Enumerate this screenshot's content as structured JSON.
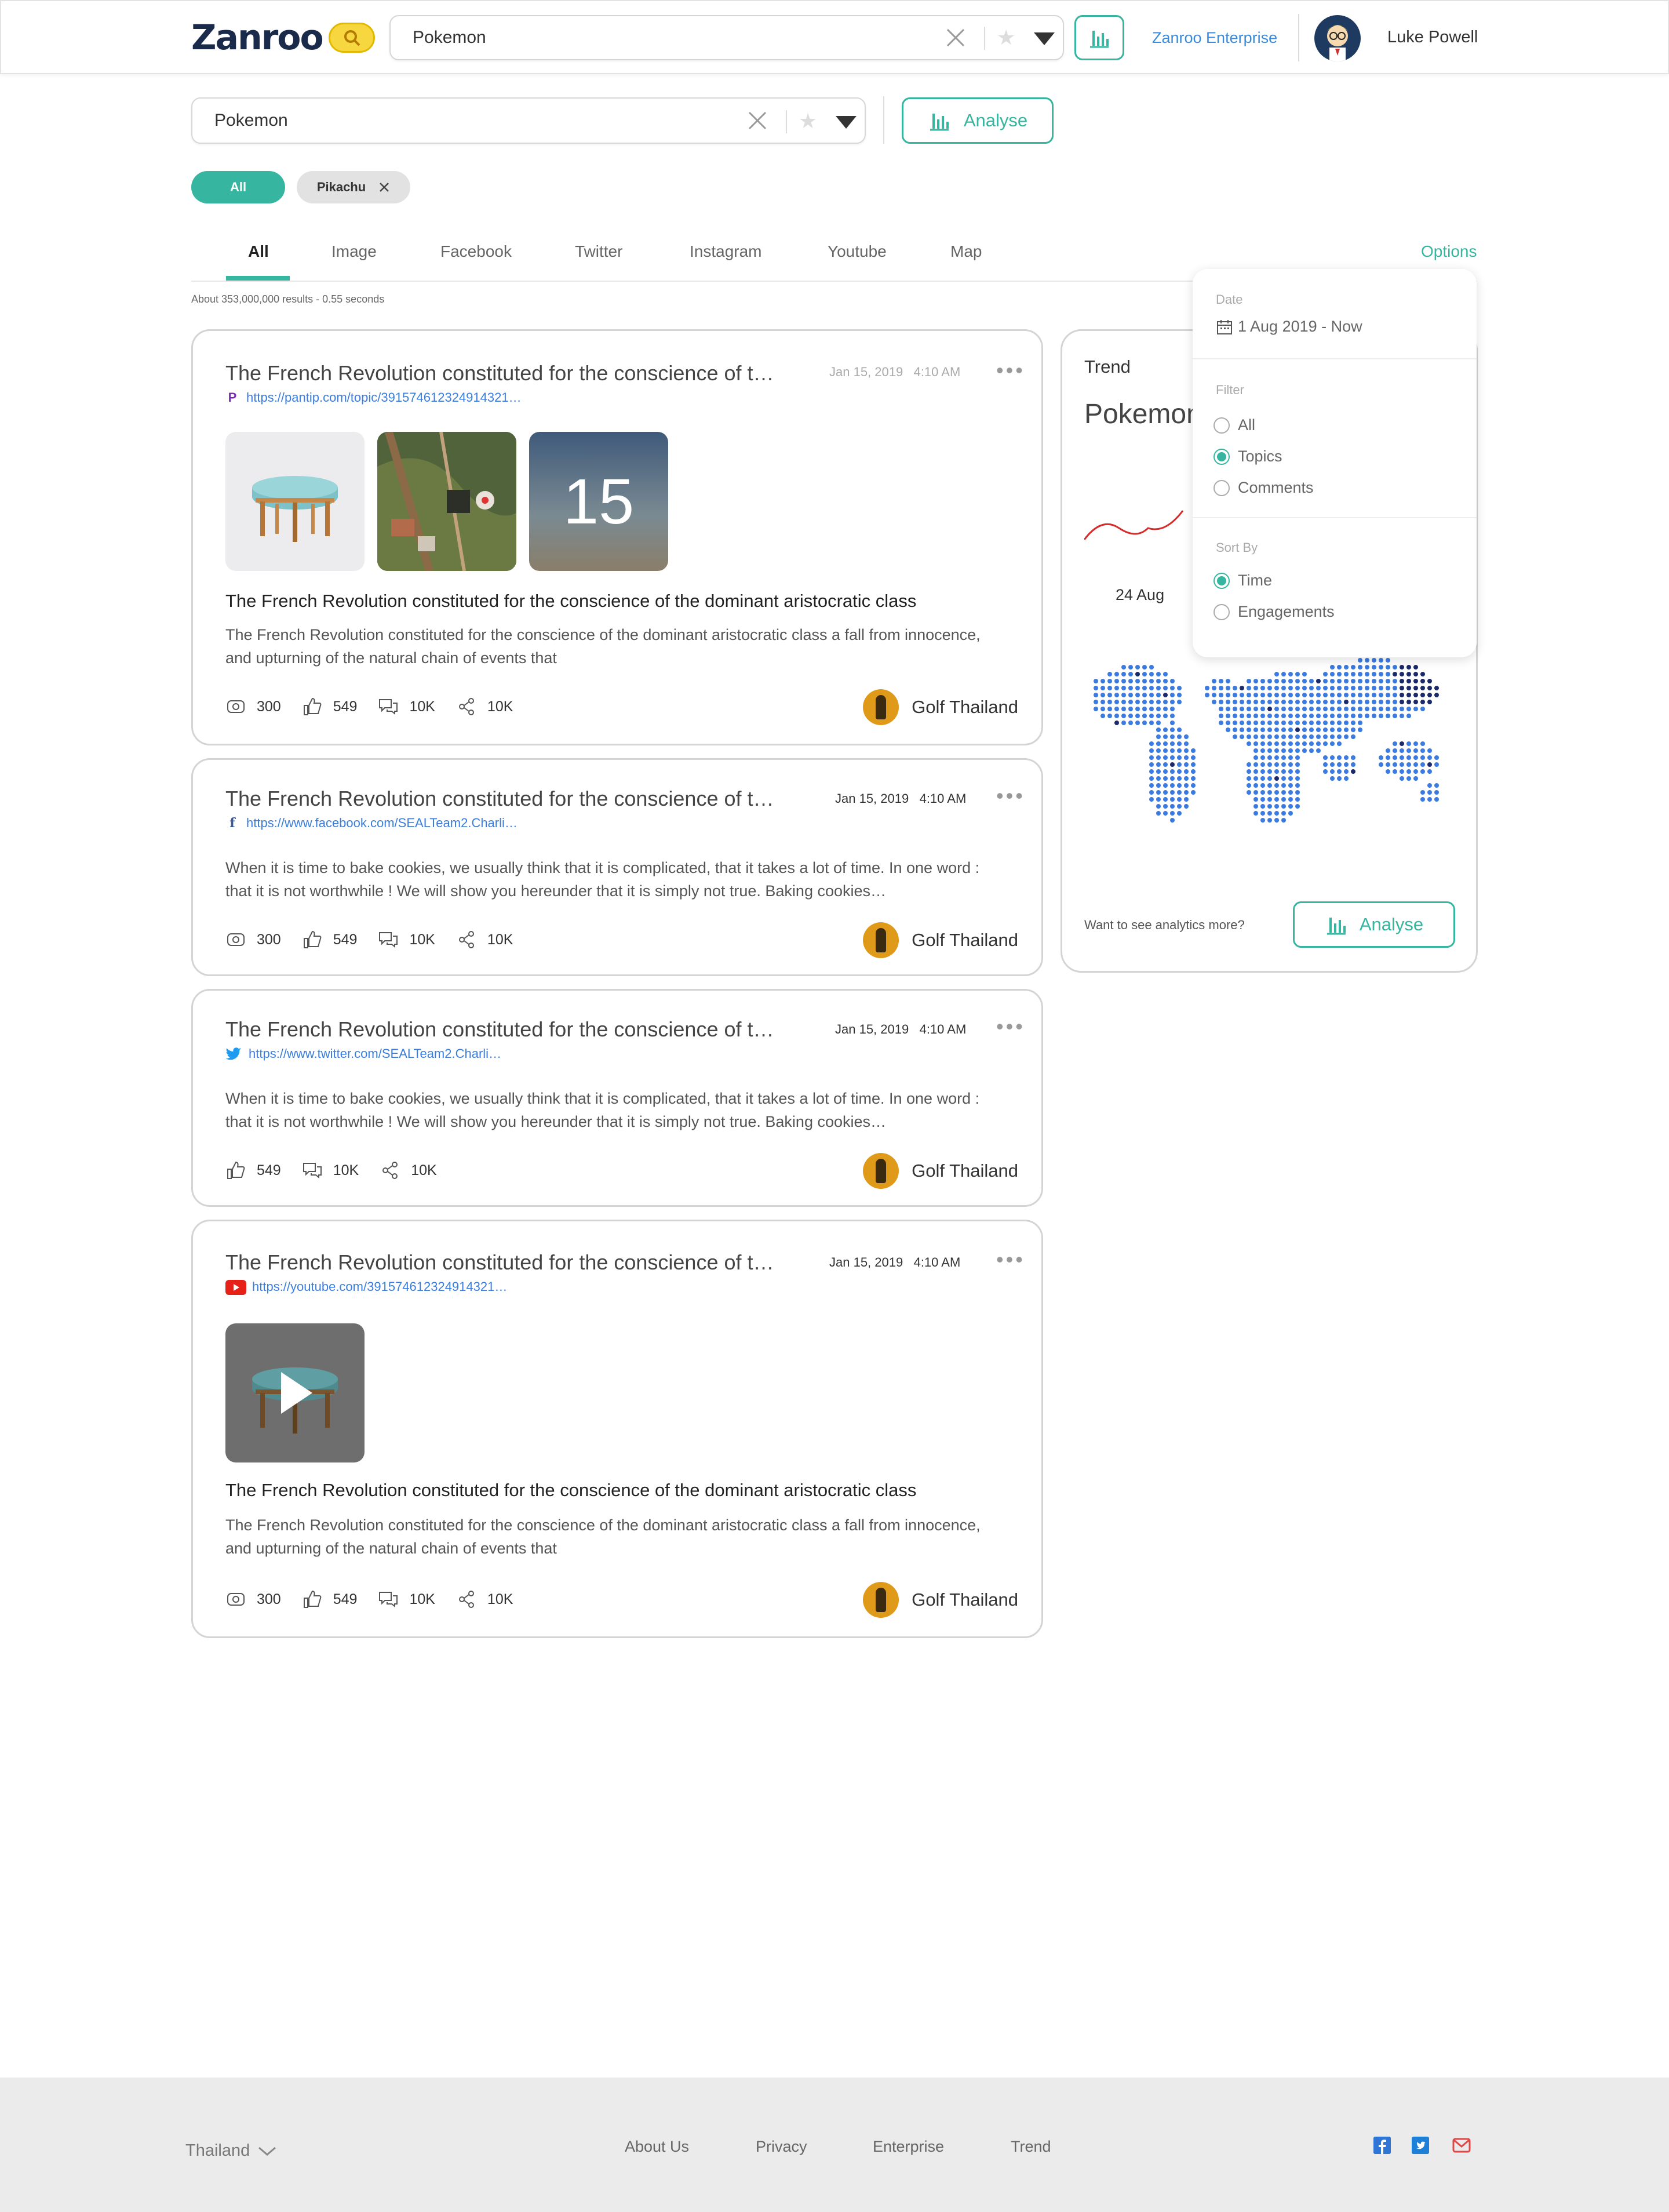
{
  "header": {
    "logo_text": "Zanroo",
    "search_value": "Pokemon",
    "enterprise_link": "Zanroo Enterprise",
    "user_name": "Luke Powell"
  },
  "search_bar": {
    "value": "Pokemon",
    "analyse_label": "Analyse"
  },
  "chips": [
    {
      "label": "All"
    },
    {
      "label": "Pikachu"
    }
  ],
  "tabs": [
    {
      "label": "All"
    },
    {
      "label": "Image"
    },
    {
      "label": "Facebook"
    },
    {
      "label": "Twitter"
    },
    {
      "label": "Instagram"
    },
    {
      "label": "Youtube"
    },
    {
      "label": "Map"
    }
  ],
  "options_label": "Options",
  "result_stats": "About 353,000,000 results - 0.55 seconds",
  "posts": [
    {
      "title": "The French Revolution constituted for the conscience of the dominant aristocratic class",
      "date": "Jan 15, 2019",
      "time": "4:10 AM",
      "source": "P",
      "url": "https://pantip.com/topic/391574612324914321…",
      "image_count": "15",
      "headline": "The French Revolution constituted for the conscience of the dominant aristocratic class",
      "body": "The French Revolution constituted for the conscience of the dominant aristocratic class a fall from innocence, and upturning of the natural chain of events that",
      "views": "300",
      "likes": "549",
      "comments": "10K",
      "shares": "10K",
      "author": "Golf Thailand"
    },
    {
      "title": "The French Revolution constituted for the conscience of the dominant aristocratic class",
      "date": "Jan 15, 2019",
      "time": "4:10 AM",
      "source": "f",
      "url": "https://www.facebook.com/SEALTeam2.Charli…",
      "body": "When it is time to bake cookies, we usually think that it is complicated, that it takes a lot of time. In one word : that it is not worthwhile ! We will show you hereunder that it is simply not true. Baking cookies…",
      "views": "300",
      "likes": "549",
      "comments": "10K",
      "shares": "10K",
      "author": "Golf Thailand"
    },
    {
      "title": "The French Revolution constituted for the conscience of the dominant aristocratic class",
      "date": "Jan 15, 2019",
      "time": "4:10 AM",
      "url": "https://www.twitter.com/SEALTeam2.Charli…",
      "body": "When it is time to bake cookies, we usually think that it is complicated, that it takes a lot of time. In one word : that it is not worthwhile ! We will show you hereunder that it is simply not true. Baking cookies…",
      "likes": "549",
      "comments": "10K",
      "shares": "10K",
      "author": "Golf Thailand"
    },
    {
      "title": "The French Revolution constituted for the conscience of the dominant aristocratic class",
      "date": "Jan 15, 2019",
      "time": "4:10 AM",
      "url": "https://youtube.com/391574612324914321…",
      "headline": "The French Revolution constituted for the conscience of the dominant aristocratic class",
      "body": "The French Revolution constituted for the conscience of the dominant aristocratic class a fall from innocence, and upturning of the natural chain of events that",
      "views": "300",
      "likes": "549",
      "comments": "10K",
      "shares": "10K",
      "author": "Golf Thailand"
    }
  ],
  "trend": {
    "label": "Trend",
    "keyword": "Pokemon",
    "date_label": "24 Aug",
    "cta_text": "Want to see analytics more?",
    "analyse_label": "Analyse"
  },
  "options_panel": {
    "date_label": "Date",
    "date_value": "1 Aug 2019 - Now",
    "filter_label": "Filter",
    "filter_options": [
      "All",
      "Topics",
      "Comments"
    ],
    "filter_selected": "Topics",
    "sort_label": "Sort By",
    "sort_options": [
      "Time",
      "Engagements"
    ],
    "sort_selected": "Time"
  },
  "footer": {
    "country": "Thailand",
    "links": [
      "About Us",
      "Privacy",
      "Enterprise",
      "Trend"
    ]
  },
  "colors": {
    "accent": "#36b5a0",
    "link": "#3b7ddd",
    "trend_line": "#d62b2b"
  }
}
